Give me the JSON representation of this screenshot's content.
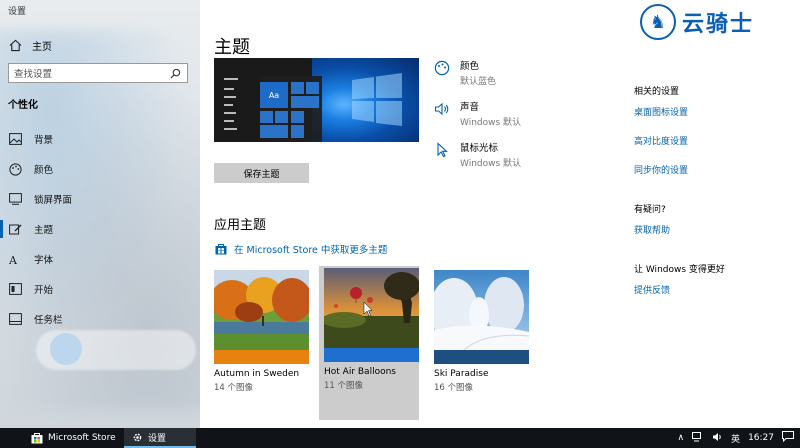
{
  "window": {
    "title": "设置"
  },
  "sidebar": {
    "home_label": "主页",
    "search_placeholder": "查找设置",
    "section_title": "个性化",
    "items": [
      {
        "label": "背景",
        "icon": "image-icon"
      },
      {
        "label": "颜色",
        "icon": "palette-icon"
      },
      {
        "label": "锁屏界面",
        "icon": "lockscreen-icon"
      },
      {
        "label": "主题",
        "icon": "theme-icon",
        "active": true
      },
      {
        "label": "字体",
        "icon": "font-icon"
      },
      {
        "label": "开始",
        "icon": "start-icon"
      },
      {
        "label": "任务栏",
        "icon": "taskbar-icon"
      }
    ]
  },
  "main": {
    "title": "主题",
    "properties": [
      {
        "label": "颜色",
        "value": "默认蓝色",
        "icon": "palette-icon"
      },
      {
        "label": "声音",
        "value": "Windows 默认",
        "icon": "speaker-icon"
      },
      {
        "label": "鼠标光标",
        "value": "Windows 默认",
        "icon": "cursor-icon"
      }
    ],
    "preview_tile_label": "Aa",
    "save_button": "保存主题",
    "apply_title": "应用主题",
    "store_link": "在 Microsoft Store 中获取更多主题",
    "themes": [
      {
        "name": "Autumn in Sweden",
        "count": "14 个图像",
        "bar_color": "#e8820e"
      },
      {
        "name": "Hot Air Balloons",
        "count": "11 个图像",
        "bar_color": "#1f6fd1",
        "selected": true
      },
      {
        "name": "Ski Paradise",
        "count": "16 个图像",
        "bar_color": "#1d4f80"
      }
    ]
  },
  "right": {
    "related_title": "相关的设置",
    "related_links": [
      "桌面图标设置",
      "高对比度设置",
      "同步你的设置"
    ],
    "question_title": "有疑问?",
    "help_link": "获取帮助",
    "better_title": "让 Windows 变得更好",
    "feedback_link": "提供反馈"
  },
  "watermark": {
    "text": "云骑士"
  },
  "taskbar": {
    "items": [
      {
        "label": "Microsoft Store",
        "icon": "store-icon"
      },
      {
        "label": "设置",
        "icon": "gear-icon",
        "active": true
      }
    ],
    "ime": "英",
    "time": "16:27"
  },
  "colors": {
    "accent": "#0063b1",
    "link": "#0063b1"
  }
}
